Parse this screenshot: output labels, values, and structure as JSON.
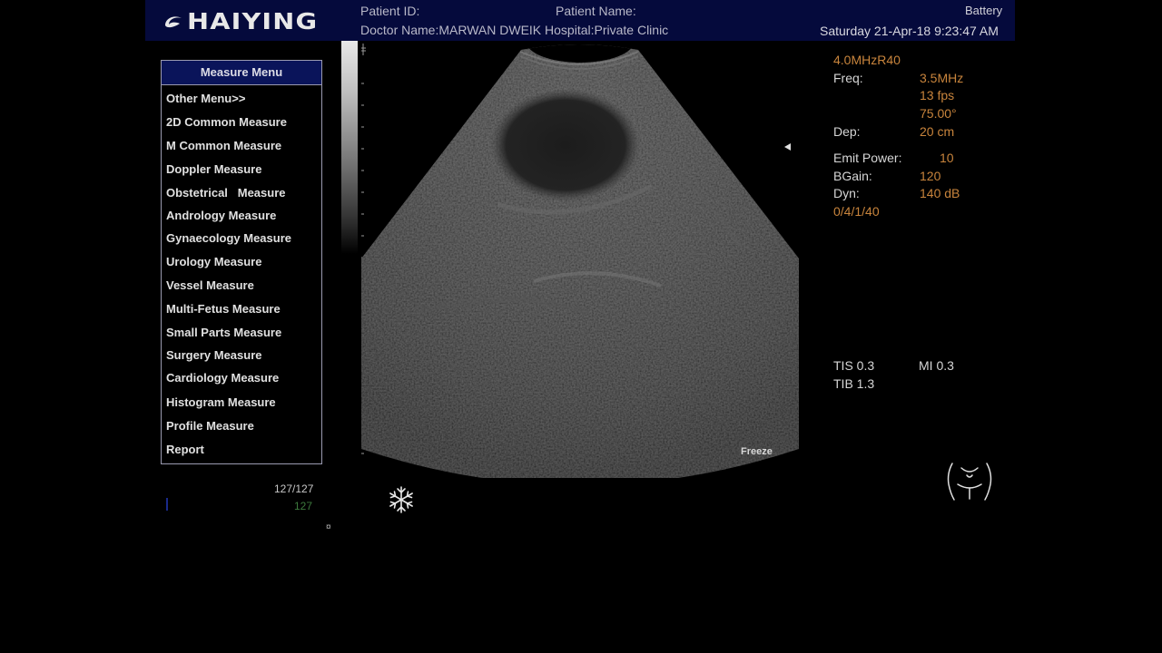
{
  "header": {
    "logo_text": "HAIYING",
    "patient_id_label": "Patient ID:",
    "patient_name_label": "Patient Name:",
    "doctor_hospital": "Doctor Name:MARWAN DWEIK Hospital:Private Clinic",
    "battery_label": "Battery",
    "datetime": "Saturday 21-Apr-18 9:23:47 AM"
  },
  "menu": {
    "title": "Measure Menu",
    "items": [
      "Other Menu>>",
      "2D Common Measure",
      "M Common Measure",
      "Doppler Measure",
      "Obstetrical   Measure",
      "Andrology Measure",
      "Gynaecology Measure",
      "Urology Measure",
      "Vessel Measure",
      "Multi-Fetus Measure",
      "Small Parts Measure",
      "Surgery Measure",
      "Cardiology Measure",
      "Histogram Measure",
      "Profile Measure",
      "Report"
    ]
  },
  "params": {
    "probe": "4.0MHzR40",
    "freq_label": "Freq:",
    "freq_value": "3.5MHz",
    "fps": "13 fps",
    "angle": "75.00°",
    "dep_label": "Dep:",
    "dep_value": "20 cm",
    "emit_label": "Emit Power:",
    "emit_value": "10",
    "bgain_label": "BGain:",
    "bgain_value": "120",
    "dyn_label": "Dyn:",
    "dyn_value": "140 dB",
    "process": "0/4/1/40",
    "tis": "TIS 0.3",
    "mi": "MI 0.3",
    "tib": "TIB 1.3"
  },
  "status": {
    "freeze_label": "Freeze",
    "cine_frames": "127/127",
    "cine_current": "127",
    "small_mark": "¤"
  },
  "icons": {
    "freeze": "snowflake-icon",
    "body": "body-mark-icon",
    "logo": "haiying-logo-icon"
  },
  "colors": {
    "header_bg": "#050a3c",
    "param_value": "#c8843c",
    "menu_title_bg": "#0a145a"
  }
}
